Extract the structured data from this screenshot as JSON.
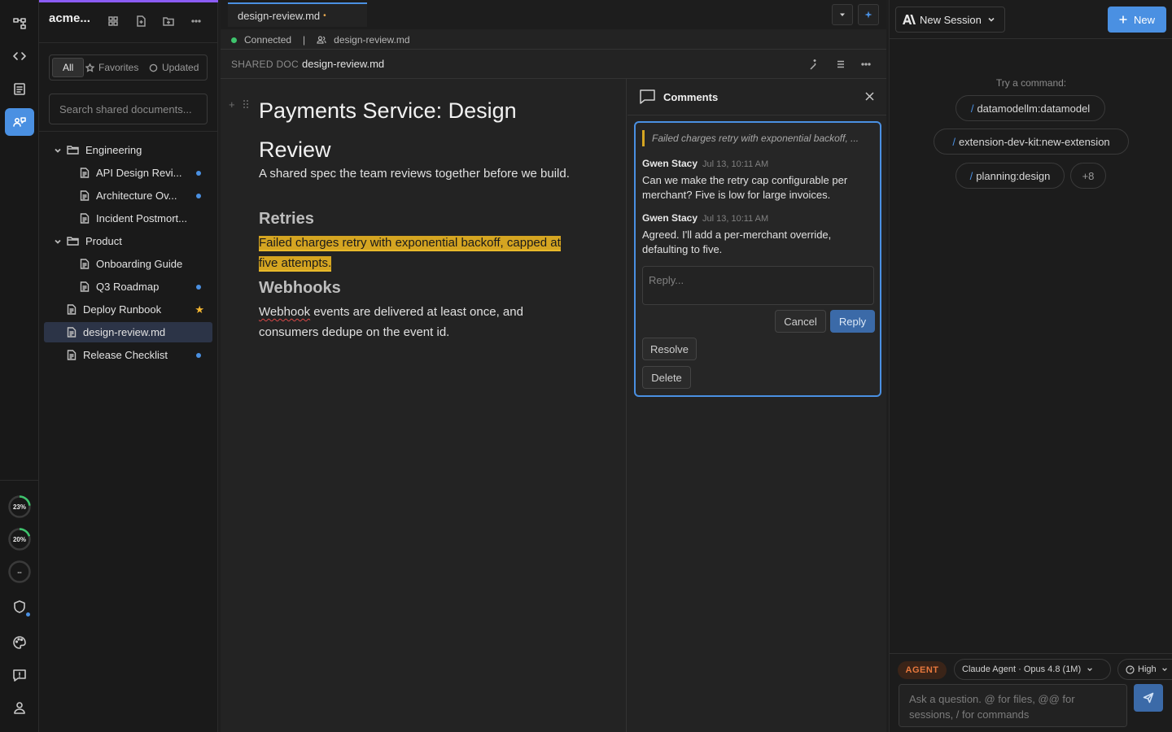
{
  "workspace": {
    "title": "acme..."
  },
  "sidebar": {
    "filters": [
      {
        "label": "All"
      },
      {
        "label": "Favorites"
      },
      {
        "label": "Updated"
      }
    ],
    "search_placeholder": "Search shared documents...",
    "tree": [
      {
        "label": "Engineering"
      },
      {
        "label": "API Design Revi..."
      },
      {
        "label": "Architecture Ov..."
      },
      {
        "label": "Incident Postmort..."
      },
      {
        "label": "Product"
      },
      {
        "label": "Onboarding Guide"
      },
      {
        "label": "Q3 Roadmap"
      },
      {
        "label": "Deploy Runbook"
      },
      {
        "label": "design-review.md"
      },
      {
        "label": "Release Checklist"
      }
    ]
  },
  "rail": {
    "gauges": [
      {
        "label": "23%",
        "value": 0.23,
        "color": "#3ec46d"
      },
      {
        "label": "20%",
        "value": 0.2,
        "color": "#3ec46d"
      },
      {
        "label": "--",
        "value": 0,
        "color": "#5a5a5a"
      }
    ]
  },
  "editor": {
    "tab_label": "design-review.md",
    "tab_modified": "•",
    "status": {
      "state": "Connected",
      "separator": "|",
      "file": "design-review.md"
    },
    "doc_header": {
      "label": "SHARED DOC",
      "name": "design-review.md"
    },
    "document": {
      "title": "Payments Service: Design Review",
      "intro": "A shared spec the team reviews together before we build.",
      "sections": [
        {
          "heading": "Retries",
          "body": "Failed charges retry with exponential backoff, capped at five attempts."
        },
        {
          "heading": "Webhooks",
          "body_word": "Webhook",
          "body_rest": " events are delivered at least once, and consumers dedupe on the event id."
        }
      ]
    }
  },
  "comments": {
    "title": "Comments",
    "quote": "Failed charges retry with exponential backoff, ...",
    "thread": [
      {
        "author": "Gwen Stacy",
        "time": "Jul 13, 10:11 AM",
        "body": "Can we make the retry cap configurable per merchant? Five is low for large invoices."
      },
      {
        "author": "Gwen Stacy",
        "time": "Jul 13, 10:11 AM",
        "body": "Agreed. I'll add a per-merchant override, defaulting to five."
      }
    ],
    "reply_placeholder": "Reply...",
    "cancel_label": "Cancel",
    "reply_label": "Reply",
    "resolve_label": "Resolve",
    "delete_label": "Delete"
  },
  "agent": {
    "session_label": "New Session",
    "new_label": "New",
    "try_label": "Try a command:",
    "commands": [
      {
        "slash": "/",
        "label": "datamodellm:datamodel"
      },
      {
        "slash": "/",
        "label": "extension-dev-kit:new-extension"
      },
      {
        "slash": "/",
        "label": "planning:design"
      }
    ],
    "more_label": "+8",
    "badge": "AGENT",
    "model": "Claude Agent · Opus 4.8 (1M)",
    "effort": "High",
    "input_placeholder": "Ask a question. @ for files, @@ for sessions, / for commands"
  },
  "colors": {
    "accent": "#4a90e2",
    "highlight": "#d5a521",
    "connected": "#3ec46d",
    "agent_badge": "#e8783d",
    "workspace_bar": "#8b5cf6"
  }
}
